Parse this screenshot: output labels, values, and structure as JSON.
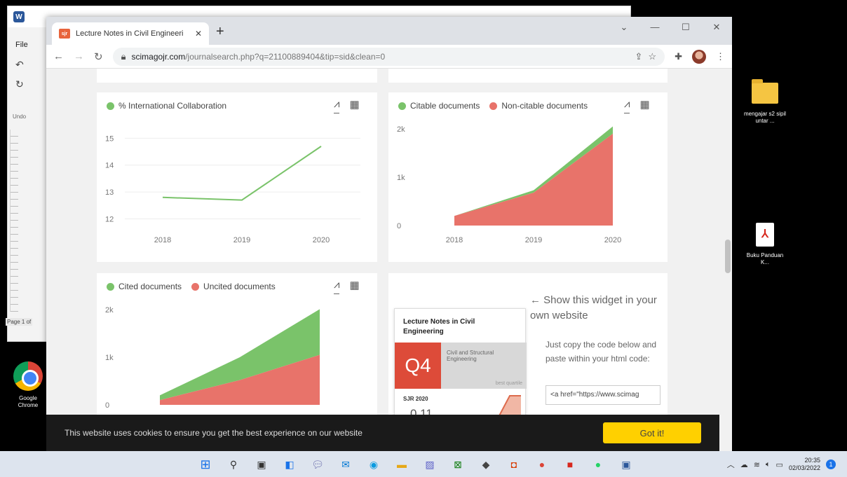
{
  "word": {
    "file_label": "File",
    "undo_label": "Undo",
    "page_label": "Page 1 of"
  },
  "browser": {
    "tab_title": "Lecture Notes in Civil Engineeri",
    "favicon": "sjr",
    "url_host": "scimagojr.com",
    "url_path": "/journalsearch.php?q=21100889404&tip=sid&clean=0",
    "window_controls": [
      "⌄",
      "—",
      "☐",
      "✕"
    ]
  },
  "charts": {
    "intl_collab": {
      "legend": "% International Collaboration",
      "color": "#7ac36a",
      "y_ticks": [
        "15",
        "14",
        "13",
        "12"
      ],
      "x_ticks": [
        "2018",
        "2019",
        "2020"
      ]
    },
    "citable": {
      "legend_1": "Citable documents",
      "legend_2": "Non-citable documents",
      "color_1": "#7ac36a",
      "color_2": "#e8736a",
      "y_ticks": [
        "2k",
        "1k",
        "0"
      ],
      "x_ticks": [
        "2018",
        "2019",
        "2020"
      ]
    },
    "cited": {
      "legend_1": "Cited documents",
      "legend_2": "Uncited documents",
      "color_1": "#7ac36a",
      "color_2": "#e8736a",
      "y_ticks": [
        "2k",
        "1k",
        "0"
      ]
    }
  },
  "chart_data": [
    {
      "type": "line",
      "x": [
        2018,
        2019,
        2020
      ],
      "series": [
        {
          "name": "% International Collaboration",
          "values": [
            12.8,
            12.7,
            14.7
          ]
        }
      ],
      "ylim": [
        11.7,
        15.4
      ]
    },
    {
      "type": "area",
      "x": [
        2018,
        2019,
        2020
      ],
      "series": [
        {
          "name": "Citable documents",
          "values": [
            200,
            680,
            1900
          ]
        },
        {
          "name": "Non-citable documents",
          "values": [
            0,
            50,
            150
          ]
        }
      ],
      "ylim": [
        0,
        2000
      ]
    },
    {
      "type": "area",
      "x": [
        2018,
        2019,
        2020
      ],
      "series": [
        {
          "name": "Cited documents",
          "values": [
            100,
            520,
            1050
          ]
        },
        {
          "name": "Uncited documents",
          "values": [
            100,
            480,
            960
          ]
        }
      ],
      "ylim": [
        0,
        2000
      ]
    }
  ],
  "widget": {
    "title": "Lecture Notes in Civil Engineering",
    "quartile": "Q4",
    "category": "Civil and Structural Engineering",
    "best_quartile": "best quartile",
    "sjr_label": "SJR 2020",
    "sjr_value": "0.11",
    "show_text": "← Show this widget in your own website",
    "copy_text": "Just copy the code below and paste within your html code:",
    "code": "<a href=\"https://www.scimag"
  },
  "cookie": {
    "text": "This website uses cookies to ensure you get the best experience on our website",
    "button": "Got it!"
  },
  "desktop": {
    "folder_label": "mengajar s2 sipil untar ...",
    "pdf_label": "Buku Panduan K...",
    "chrome_label": "Google Chrome"
  },
  "taskbar": {
    "time": "20:35",
    "date": "02/03/2022"
  }
}
